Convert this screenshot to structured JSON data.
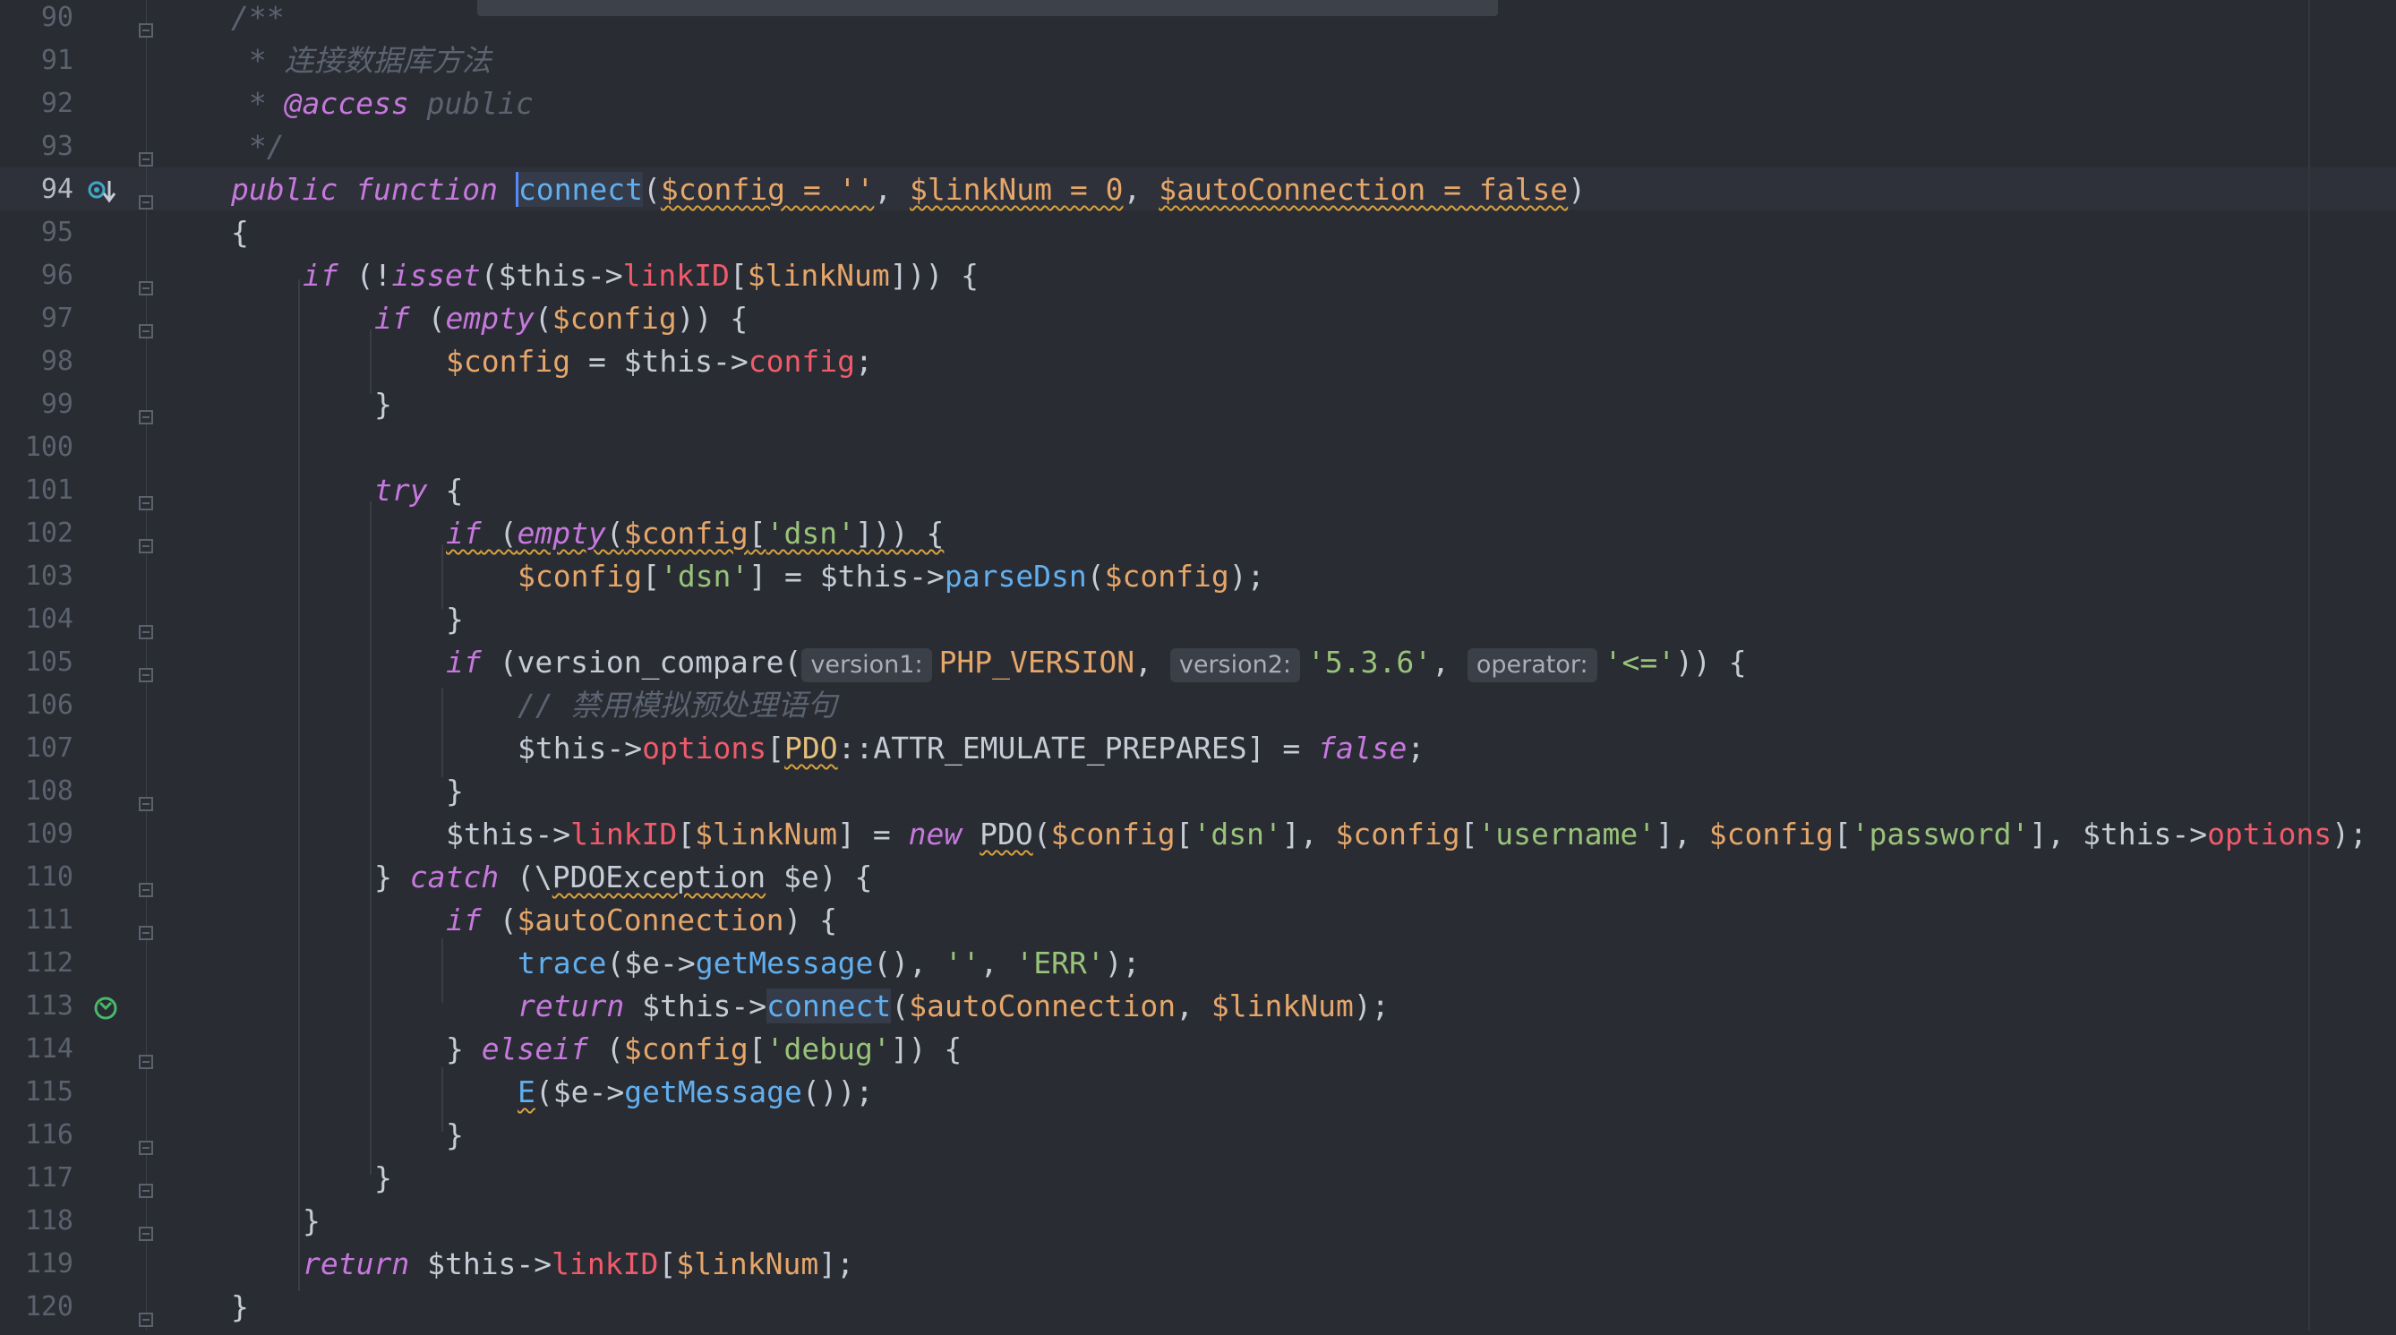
{
  "editor": {
    "active_line": "94",
    "colors": {
      "background": "#292c33",
      "keyword": "#c678dd",
      "variable": "#e5a66a",
      "string": "#98c379",
      "property": "#ef5b6b",
      "function": "#61afef",
      "comment": "#5c6370"
    },
    "gutter_icons": {
      "line_94": "implementation-marker-icon",
      "line_113": "recursive-call-icon"
    },
    "lines": [
      {
        "n": "90"
      },
      {
        "n": "91"
      },
      {
        "n": "92"
      },
      {
        "n": "93"
      },
      {
        "n": "94"
      },
      {
        "n": "95"
      },
      {
        "n": "96"
      },
      {
        "n": "97"
      },
      {
        "n": "98"
      },
      {
        "n": "99"
      },
      {
        "n": "100"
      },
      {
        "n": "101"
      },
      {
        "n": "102"
      },
      {
        "n": "103"
      },
      {
        "n": "104"
      },
      {
        "n": "105"
      },
      {
        "n": "106"
      },
      {
        "n": "107"
      },
      {
        "n": "108"
      },
      {
        "n": "109"
      },
      {
        "n": "110"
      },
      {
        "n": "111"
      },
      {
        "n": "112"
      },
      {
        "n": "113"
      },
      {
        "n": "114"
      },
      {
        "n": "115"
      },
      {
        "n": "116"
      },
      {
        "n": "117"
      },
      {
        "n": "118"
      },
      {
        "n": "119"
      },
      {
        "n": "120"
      }
    ],
    "code": {
      "l90": "/**",
      "l91": " * 连接数据库方法",
      "l92_star": " * ",
      "l92_tag": "@access",
      "l92_rest": " public",
      "l93": " */",
      "l94_kw1": "public",
      "l94_kw2": "function",
      "l94_name": "connect",
      "l94_p1": "$config = ''",
      "l94_p2": "$linkNum = 0",
      "l94_p3": "$autoConnection = false",
      "l95": "{",
      "l96_kw": "if",
      "l96_fn": "isset",
      "l96_this": "$this->",
      "l96_prop": "linkID",
      "l96_var": "$linkNum",
      "l97_kw": "if",
      "l97_fn": "empty",
      "l97_var": "$config",
      "l98_var": "$config",
      "l98_this": " = $this->",
      "l98_prop": "config",
      "l99": "}",
      "l101_kw": "try",
      "l102_kw": "if",
      "l102_fn": "empty",
      "l102_var": "$config",
      "l102_str": "'dsn'",
      "l103_var": "$config",
      "l103_str": "'dsn'",
      "l103_this": "] = $this->",
      "l103_fn": "parseDsn",
      "l103_var2": "$config",
      "l104": "}",
      "l105_kw": "if",
      "l105_fn": "version_compare(",
      "l105_h1": "version1:",
      "l105_c1": "PHP_VERSION",
      "l105_h2": "version2:",
      "l105_s2": "'5.3.6'",
      "l105_h3": "operator:",
      "l105_s3": "'<='",
      "l106": "// 禁用模拟预处理语句",
      "l107_this": "$this->",
      "l107_prop": "options",
      "l107_cls": "PDO",
      "l107_const": "::ATTR_EMULATE_PREPARES] = ",
      "l107_kw": "false",
      "l108": "}",
      "l109_this": "$this->",
      "l109_prop": "linkID",
      "l109_var": "$linkNum",
      "l109_kw": "new",
      "l109_cls": "PDO",
      "l109_v1": "$config",
      "l109_s1": "'dsn'",
      "l109_v2": "$config",
      "l109_s2": "'username'",
      "l109_v3": "$config",
      "l109_s3": "'password'",
      "l109_this2": "$this->",
      "l109_prop2": "options",
      "l110_kw": "catch",
      "l110_cls": "PDOException",
      "l110_var": "$e",
      "l111_kw": "if",
      "l111_var": "$autoConnection",
      "l112_fn": "trace",
      "l112_e": "$e->",
      "l112_m": "getMessage",
      "l112_s1": "''",
      "l112_s2": "'ERR'",
      "l113_kw": "return",
      "l113_this": " $this->",
      "l113_fn": "connect",
      "l113_v1": "$autoConnection",
      "l113_v2": "$linkNum",
      "l114_kw": "elseif",
      "l114_var": "$config",
      "l114_str": "'debug'",
      "l115_fn": "E",
      "l115_e": "$e->",
      "l115_m": "getMessage",
      "l116": "}",
      "l117": "}",
      "l118": "}",
      "l119_kw": "return",
      "l119_this": " $this->",
      "l119_prop": "linkID",
      "l119_var": "$linkNum",
      "l120": "}"
    }
  }
}
